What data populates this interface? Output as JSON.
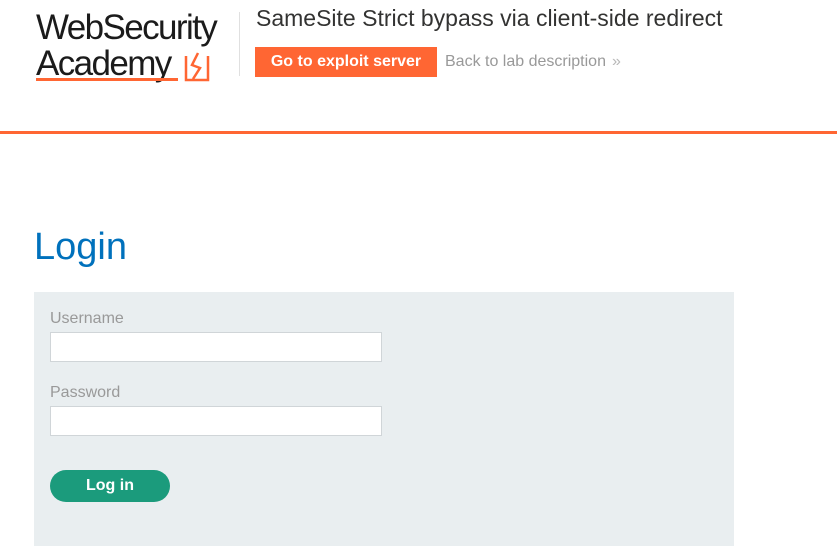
{
  "brand": {
    "line1": "WebSecurity",
    "line2": "Academy",
    "accent_color": "#ff6633",
    "icon": "lightning-bolt-icon"
  },
  "header": {
    "lab_title": "SameSite Strict bypass via client-side redirect",
    "exploit_button_label": "Go to exploit server",
    "back_link_label": "Back to lab description",
    "back_link_icon": "double-chevron-right-icon",
    "back_link_chevron": "»"
  },
  "login": {
    "title": "Login",
    "username_label": "Username",
    "username_value": "",
    "password_label": "Password",
    "password_value": "",
    "submit_label": "Log in",
    "title_color": "#0071bc",
    "button_color": "#1b9b7c",
    "panel_color": "#e9eef0"
  }
}
